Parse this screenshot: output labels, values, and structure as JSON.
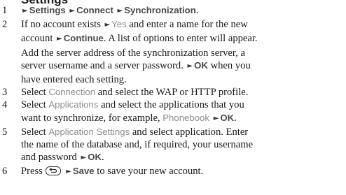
{
  "heading": "Settings",
  "steps": [
    {
      "number": "1",
      "menu_settings": "Settings",
      "menu_connect": "Connect",
      "menu_synchronization": "Synchronization",
      "period": "."
    },
    {
      "number": "2",
      "text_a": "If no account exists",
      "option_yes": "Yes",
      "text_b": "and enter a name for the new",
      "text_c": "account",
      "option_continue": "Continue",
      "text_d": ". A list of options to enter will appear.",
      "line3": "Add the server address of the synchronization server, a",
      "text_e": "server username and a server password.",
      "option_ok": "OK",
      "text_f": "when you",
      "line5": "have entered each setting."
    },
    {
      "number": "3",
      "text_a": "Select",
      "option_connection": "Connection",
      "text_b": "and select the WAP or HTTP profile."
    },
    {
      "number": "4",
      "text_a": "Select",
      "option_applications": "Applications",
      "text_b": "and select the applications that you",
      "text_c": "want to synchronize, for example,",
      "option_phonebook": "Phonebook",
      "option_ok": "OK",
      "period": "."
    },
    {
      "number": "5",
      "text_a": "Select",
      "option_app_settings": "Application Settings",
      "text_b": "and select application. Enter",
      "line2": "the name of the database and, if required, your username",
      "text_c": "and password",
      "option_ok": "OK",
      "period": "."
    },
    {
      "number": "6",
      "text_a": "Press",
      "back_key_icon": "back-key-icon",
      "option_save": "Save",
      "text_b": "to save your new account."
    }
  ],
  "arrow_glyph": "►"
}
